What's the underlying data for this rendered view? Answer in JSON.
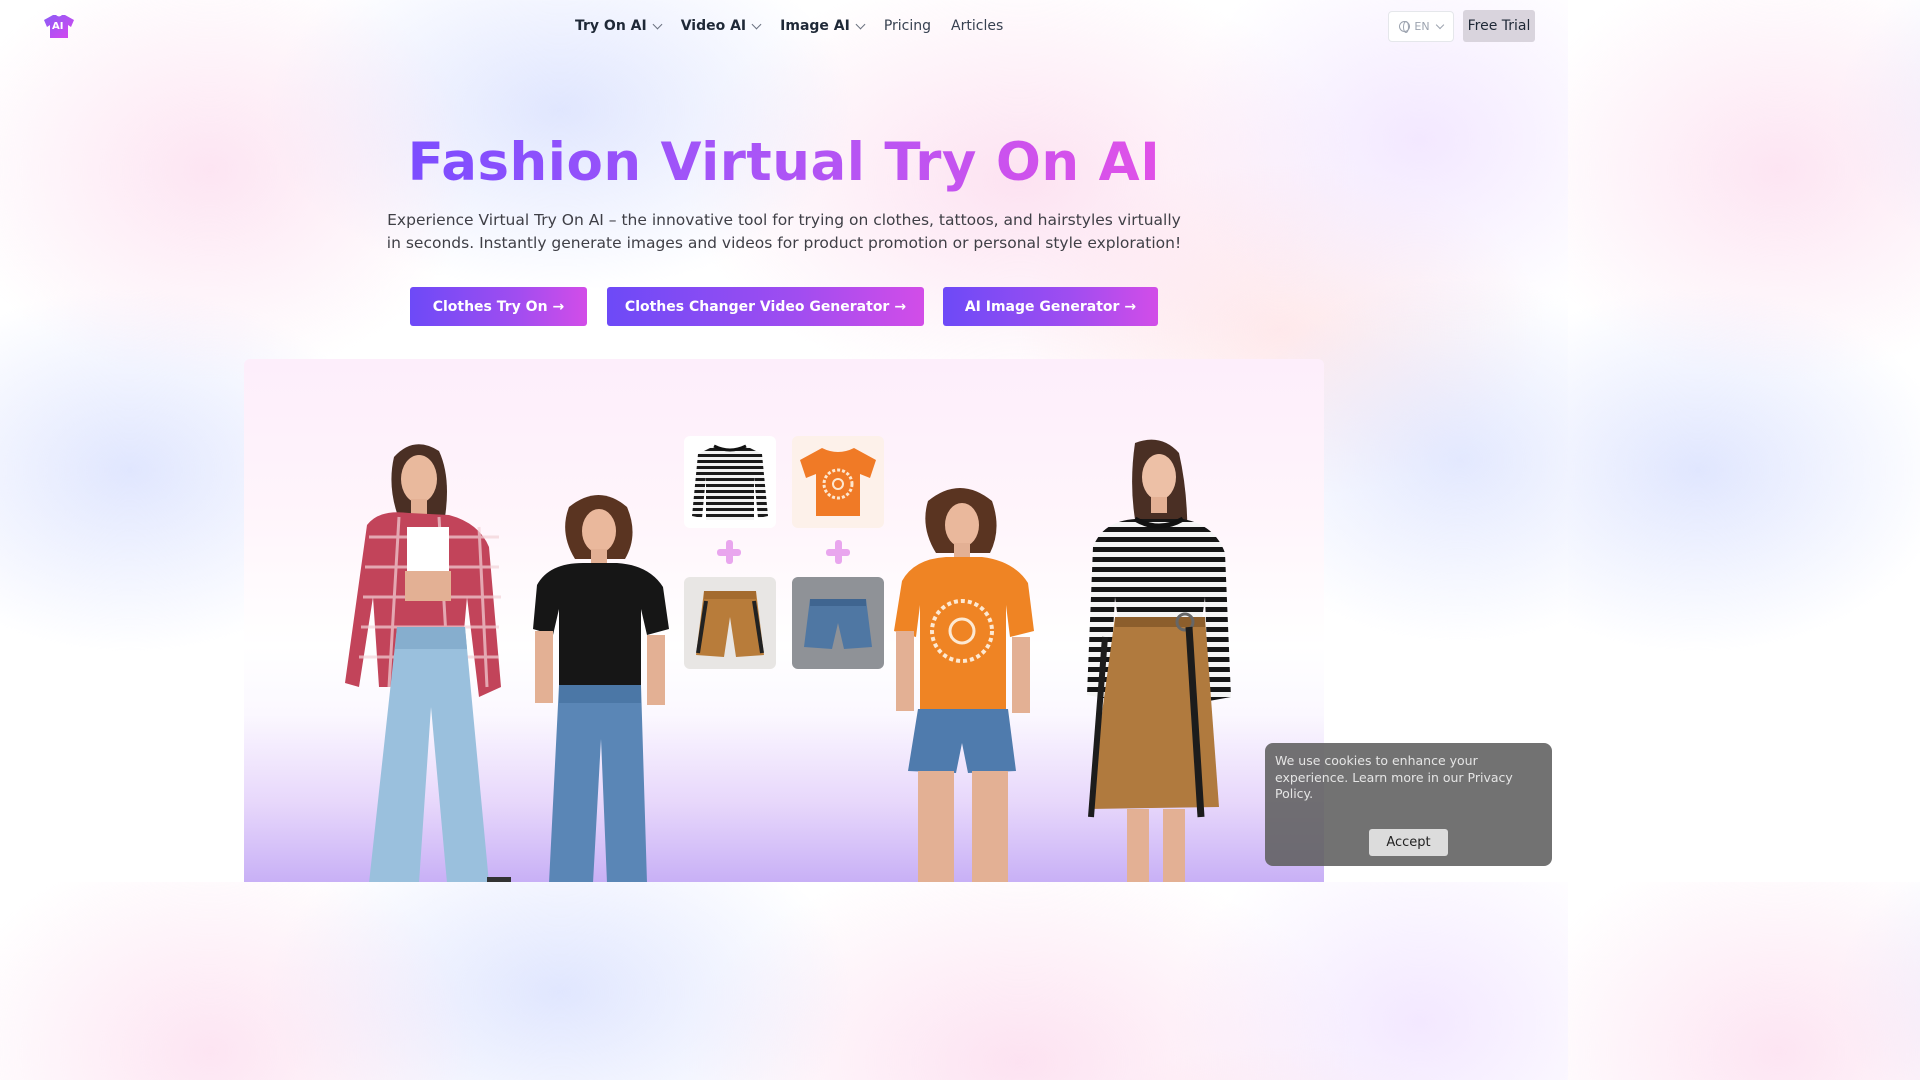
{
  "header": {
    "logo_text": "AI",
    "nav": [
      {
        "label": "Try On AI",
        "dropdown": true
      },
      {
        "label": "Video AI",
        "dropdown": true
      },
      {
        "label": "Image AI",
        "dropdown": true
      },
      {
        "label": "Pricing",
        "dropdown": false
      },
      {
        "label": "Articles",
        "dropdown": false
      }
    ],
    "language": "EN",
    "free_trial_label": "Free Trial"
  },
  "hero": {
    "title": "Fashion Virtual Try On AI",
    "subtitle": "Experience Virtual Try On AI – the innovative tool for trying on clothes, tattoos, and hairstyles virtually in seconds. Instantly generate images and videos for product promotion or personal style exploration!",
    "buttons": [
      {
        "label": "Clothes Try On",
        "arrow": "→"
      },
      {
        "label": "Clothes Changer Video Generator",
        "arrow": "→"
      },
      {
        "label": "AI Image Generator",
        "arrow": "→"
      }
    ]
  },
  "showcase": {
    "garments": [
      "striped-longsleeve-icon",
      "orange-tshirt-icon",
      "brown-shorts-icon",
      "denim-shorts-icon"
    ],
    "models": [
      "model-plaid-shirt-jeans",
      "model-black-tee-jeans",
      "model-orange-tee-shorts",
      "model-striped-top-skirt"
    ]
  },
  "cookie": {
    "text": "We use cookies to enhance your experience. Learn more in our Privacy Policy.",
    "accept_label": "Accept"
  },
  "colors": {
    "brand_start": "#6d4af7",
    "brand_end": "#d24de8",
    "title_gradient": [
      "#7c4dff",
      "#a855f7",
      "#e051e8"
    ]
  }
}
